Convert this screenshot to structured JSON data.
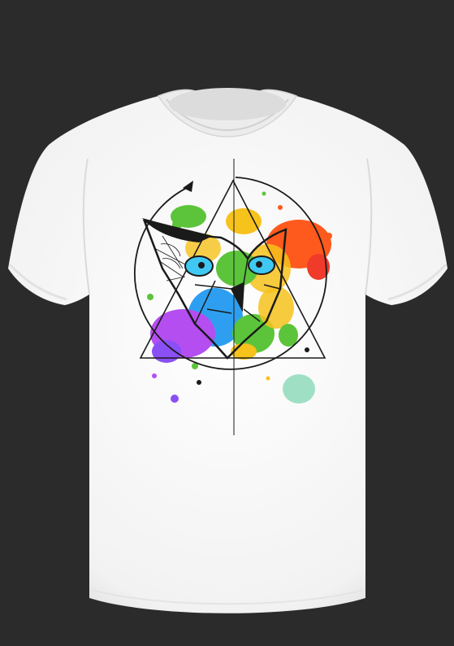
{
  "scene": {
    "subject": "t-shirt-mockup",
    "print": "geometric-owl-with-paint-splatter"
  },
  "colors": {
    "background": "#2b2b2b",
    "shirt": "#f7f7f7",
    "shirt_shadow": "#dcdcdc",
    "collar": "#e9e9e9",
    "line_art": "#1a1a1a",
    "eye": "#3fc9f2",
    "splash_green": "#5cc43a",
    "splash_orange": "#ff5a1e",
    "splash_yellow": "#f6c21c",
    "splash_purple": "#b44ef0",
    "splash_violet": "#8a4ff5",
    "splash_blue": "#2e9ff0",
    "splash_mint": "#9fe0c4",
    "splash_red": "#f03a2a"
  },
  "icons": [
    "owl-graphic",
    "triangle-icon",
    "circle-arrow-icon",
    "paint-splatter"
  ]
}
